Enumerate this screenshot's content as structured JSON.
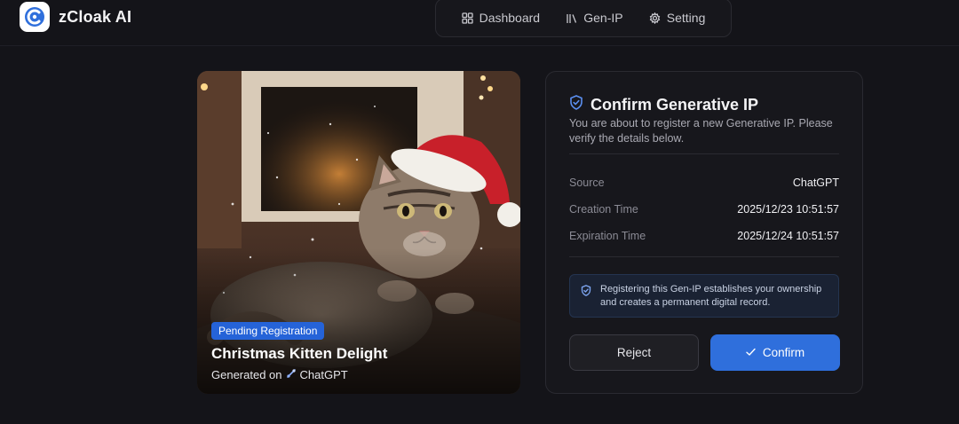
{
  "brand": {
    "name": "zCloak AI",
    "logo_icon": "zcloak-logo-icon"
  },
  "nav": {
    "items": [
      {
        "label": "Dashboard",
        "icon": "dashboard-grid-icon"
      },
      {
        "label": "Gen-IP",
        "icon": "library-icon"
      },
      {
        "label": "Setting",
        "icon": "gear-icon"
      }
    ]
  },
  "artwork": {
    "badge": "Pending Registration",
    "title": "Christmas Kitten Delight",
    "generated_prefix": "Generated on",
    "generated_source": "ChatGPT",
    "source_icon": "chatgpt-icon"
  },
  "confirm": {
    "title": "Confirm Generative IP",
    "description": "You are about to register a new Generative IP. Please verify the details below.",
    "details": [
      {
        "key": "Source",
        "value": "ChatGPT"
      },
      {
        "key": "Creation Time",
        "value": "2025/12/23 10:51:57"
      },
      {
        "key": "Expiration Time",
        "value": "2025/12/24 10:51:57"
      }
    ],
    "notice": "Registering this Gen-IP establishes your ownership and creates a permanent digital record.",
    "reject_label": "Reject",
    "confirm_label": "Confirm"
  },
  "colors": {
    "background": "#141419",
    "accent": "#2f6fdc",
    "badge": "#2563d8",
    "card_border": "#2a2a31"
  }
}
